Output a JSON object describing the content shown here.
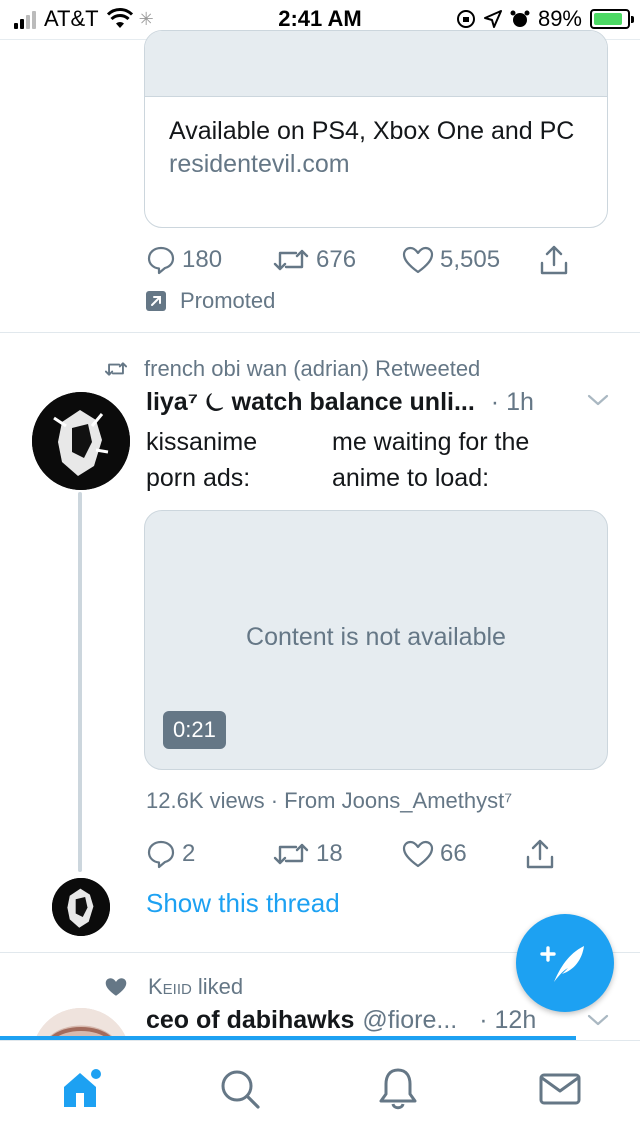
{
  "status_bar": {
    "carrier": "AT&T",
    "time": "2:41 AM",
    "battery_percent": "89%",
    "battery_level": 0.89,
    "signal_bars_active": 2
  },
  "promoted_tweet": {
    "card_title": "Available on PS4, Xbox One and PC",
    "card_domain": "residentevil.com",
    "replies": "180",
    "retweets": "676",
    "likes": "5,505",
    "promoted_label": "Promoted"
  },
  "tweet": {
    "retweeted_by": "french obi wan (adrian) Retweeted",
    "author_name": "liya⁷ ⏾ watch balance unli...",
    "time": "· 1h",
    "text_col1_line1": "kissanime",
    "text_col1_line2": "porn ads:",
    "text_col2_line1": "me waiting for the",
    "text_col2_line2": "anime to load:",
    "media_message": "Content is not available",
    "video_duration": "0:21",
    "views_line": "12.6K views · From Joons_Amethyst⁷",
    "replies": "2",
    "retweets": "18",
    "likes": "66",
    "show_thread": "Show this thread"
  },
  "next_tweet": {
    "liked_by_name": "Keiid",
    "liked_suffix": "liked",
    "author_name": "ceo of dabihawks",
    "handle": "@fiore...",
    "time": "· 12h"
  },
  "colors": {
    "accent": "#1da1f2",
    "secondary_text": "#657786",
    "border": "#ccd6dd"
  },
  "tabs": [
    "home-icon",
    "search-icon",
    "notifications-icon",
    "messages-icon"
  ]
}
